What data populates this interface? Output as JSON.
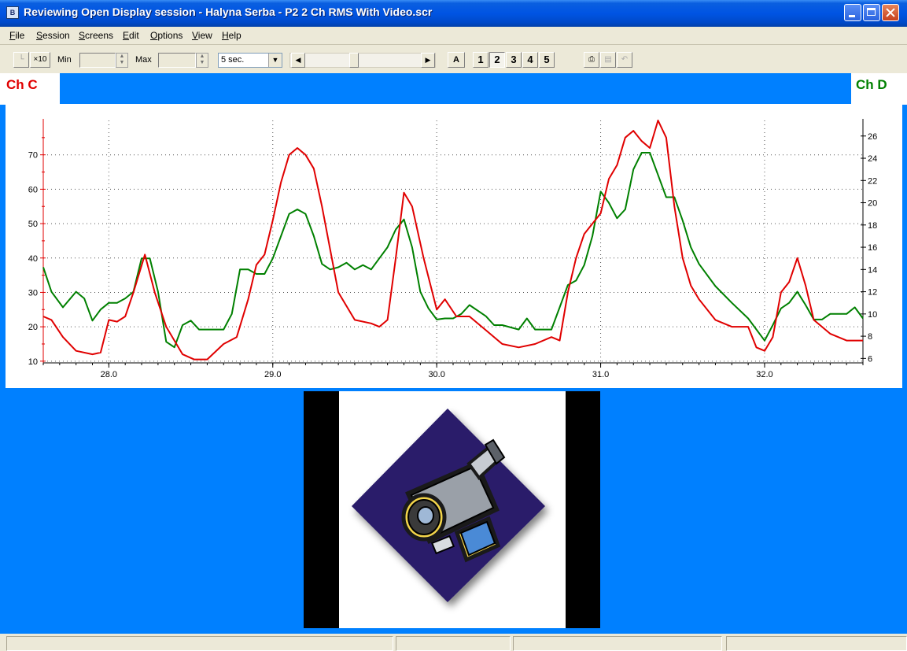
{
  "window": {
    "title": "Reviewing Open Display session - Halyna Serba - P2 2 Ch RMS With Video.scr"
  },
  "menu": [
    "File",
    "Session",
    "Screens",
    "Edit",
    "Options",
    "View",
    "Help"
  ],
  "toolbar": {
    "x10_label": "×10",
    "min_label": "Min",
    "max_label": "Max",
    "timebase_value": "5 sec.",
    "auto_label": "A",
    "screen_buttons": [
      "1",
      "2",
      "3",
      "4",
      "5"
    ],
    "active_screen": "2"
  },
  "channels": {
    "left_label": "Ch C",
    "right_label": "Ch D",
    "left_color": "#e00000",
    "right_color": "#008000",
    "strip_color": "#0080ff"
  },
  "chart_data": {
    "type": "line",
    "x_range": [
      27.6,
      32.6
    ],
    "x_ticks": [
      28.0,
      29.0,
      30.0,
      31.0,
      32.0
    ],
    "x_tick_labels": [
      "28.0",
      "29.0",
      "30.0",
      "31.0",
      "32.0"
    ],
    "y_left": {
      "range": [
        9.5,
        80
      ],
      "ticks": [
        10,
        20,
        30,
        40,
        50,
        60,
        70
      ],
      "tick_labels": [
        "10",
        "20",
        "30",
        "40",
        "50",
        "60",
        "70"
      ]
    },
    "y_right": {
      "range": [
        5.6,
        27.4
      ],
      "ticks": [
        6,
        8,
        10,
        12,
        14,
        16,
        18,
        20,
        22,
        24,
        26
      ],
      "tick_labels": [
        "6",
        "8",
        "10",
        "12",
        "14",
        "16",
        "18",
        "20",
        "22",
        "24",
        "26"
      ]
    },
    "grid": true,
    "series": [
      {
        "name": "Ch C",
        "axis": "left",
        "color": "#e00000",
        "x": [
          27.6,
          27.65,
          27.72,
          27.8,
          27.9,
          27.95,
          28.0,
          28.05,
          28.1,
          28.15,
          28.22,
          28.28,
          28.35,
          28.45,
          28.52,
          28.6,
          28.7,
          28.78,
          28.85,
          28.9,
          28.95,
          29.0,
          29.05,
          29.1,
          29.15,
          29.2,
          29.25,
          29.3,
          29.4,
          29.5,
          29.6,
          29.65,
          29.7,
          29.75,
          29.8,
          29.85,
          29.92,
          30.0,
          30.05,
          30.12,
          30.2,
          30.3,
          30.4,
          30.5,
          30.6,
          30.7,
          30.75,
          30.8,
          30.85,
          30.9,
          30.95,
          31.0,
          31.05,
          31.1,
          31.15,
          31.2,
          31.25,
          31.3,
          31.35,
          31.4,
          31.45,
          31.5,
          31.55,
          31.6,
          31.7,
          31.8,
          31.9,
          31.95,
          32.0,
          32.05,
          32.1,
          32.15,
          32.2,
          32.25,
          32.3,
          32.4,
          32.5,
          32.6
        ],
        "y": [
          23,
          22,
          17,
          13,
          12,
          12.5,
          22,
          21.5,
          23,
          30,
          41,
          30,
          20,
          12,
          10.5,
          10.5,
          15,
          17,
          28,
          38,
          41,
          51,
          62,
          70,
          72,
          70,
          66,
          55,
          30,
          22,
          21,
          20,
          22,
          40,
          59,
          55,
          40,
          25,
          28,
          23,
          23,
          19,
          15,
          14,
          15,
          17,
          16,
          30,
          40,
          47,
          50,
          53,
          63,
          67,
          75,
          77,
          74,
          72,
          80,
          75,
          55,
          40,
          32,
          28,
          22,
          20,
          20,
          14,
          13,
          17,
          30,
          33,
          40,
          32,
          22,
          18,
          16,
          16
        ]
      },
      {
        "name": "Ch D",
        "axis": "right",
        "color": "#008000",
        "x": [
          27.6,
          27.65,
          27.72,
          27.8,
          27.85,
          27.9,
          27.95,
          28.0,
          28.05,
          28.1,
          28.15,
          28.2,
          28.25,
          28.3,
          28.35,
          28.4,
          28.45,
          28.5,
          28.55,
          28.6,
          28.7,
          28.75,
          28.8,
          28.85,
          28.9,
          28.95,
          29.0,
          29.05,
          29.1,
          29.15,
          29.2,
          29.25,
          29.3,
          29.35,
          29.4,
          29.45,
          29.5,
          29.55,
          29.6,
          29.65,
          29.7,
          29.75,
          29.8,
          29.85,
          29.9,
          29.95,
          30.0,
          30.05,
          30.1,
          30.15,
          30.2,
          30.3,
          30.35,
          30.4,
          30.5,
          30.55,
          30.6,
          30.7,
          30.75,
          30.8,
          30.85,
          30.9,
          30.95,
          31.0,
          31.05,
          31.1,
          31.15,
          31.2,
          31.25,
          31.3,
          31.35,
          31.4,
          31.45,
          31.5,
          31.55,
          31.6,
          31.7,
          31.8,
          31.9,
          32.0,
          32.05,
          32.1,
          32.15,
          32.2,
          32.25,
          32.3,
          32.35,
          32.4,
          32.5,
          32.55,
          32.6
        ],
        "y": [
          14.2,
          12,
          10.6,
          12,
          11.4,
          9.4,
          10.4,
          11,
          11,
          11.4,
          12,
          15,
          15,
          12,
          7.5,
          7,
          9,
          9.4,
          8.6,
          8.6,
          8.6,
          10,
          14,
          14,
          13.6,
          13.6,
          15,
          17,
          19,
          19.4,
          19,
          17,
          14.5,
          14,
          14.2,
          14.6,
          14,
          14.4,
          14,
          15,
          16,
          17.6,
          18.5,
          16,
          12,
          10.5,
          9.5,
          9.6,
          9.6,
          10,
          10.8,
          9.8,
          9,
          9,
          8.6,
          9.6,
          8.6,
          8.6,
          10.6,
          12.6,
          13,
          14.4,
          17,
          21,
          20,
          18.6,
          19.4,
          23,
          24.5,
          24.5,
          22.5,
          20.5,
          20.5,
          18.4,
          16,
          14.5,
          12.5,
          11,
          9.6,
          7.6,
          9,
          10.5,
          11,
          12,
          10.8,
          9.5,
          9.5,
          10,
          10,
          10.6,
          9.6
        ]
      }
    ]
  },
  "video": {
    "icon": "camcorder-icon"
  }
}
